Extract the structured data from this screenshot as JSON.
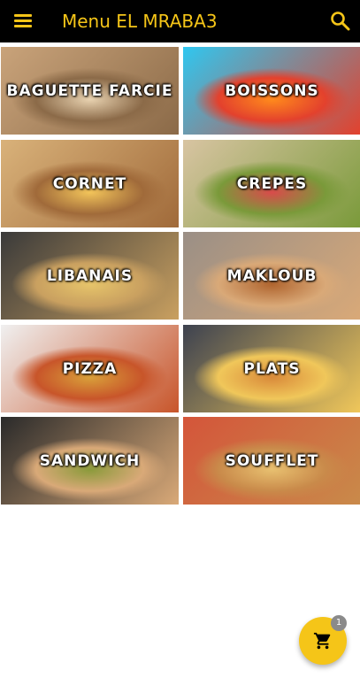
{
  "appbar": {
    "title": "Menu EL MRABA3",
    "menu_icon": "hamburger-menu-icon",
    "search_icon": "search-icon",
    "background": "#000000",
    "accent": "#F5C518"
  },
  "categories": [
    {
      "label": "BAGUETTE FARCIE",
      "colors": [
        "#c9a37a",
        "#8b6a48",
        "#e8d2b0"
      ]
    },
    {
      "label": "BOISSONS",
      "colors": [
        "#2fc7f0",
        "#e3412d",
        "#ff8a1c"
      ]
    },
    {
      "label": "CORNET",
      "colors": [
        "#d9b27a",
        "#a06a3a",
        "#f2c45a"
      ]
    },
    {
      "label": "CREPES",
      "colors": [
        "#d8c4a2",
        "#7a9a3a",
        "#d94b4b"
      ]
    },
    {
      "label": "LIBANAIS",
      "colors": [
        "#3a3a3a",
        "#c9a060",
        "#e6c46a"
      ]
    },
    {
      "label": "MAKLOUB",
      "colors": [
        "#9a8f86",
        "#d9a978",
        "#b0652f"
      ]
    },
    {
      "label": "PIZZA",
      "colors": [
        "#f0f0f0",
        "#c8552a",
        "#d9a03a"
      ]
    },
    {
      "label": "PLATS",
      "colors": [
        "#3d4250",
        "#f0c75a",
        "#d98a3a"
      ]
    },
    {
      "label": "SANDWICH",
      "colors": [
        "#2a2a2a",
        "#d9a978",
        "#8a9a3a"
      ]
    },
    {
      "label": "SOUFFLET",
      "colors": [
        "#d4553a",
        "#c98a4a",
        "#e8c070"
      ]
    }
  ],
  "cart": {
    "icon": "shopping-cart-icon",
    "count": "1",
    "fab_color": "#F5C518",
    "badge_color": "#8a8a8a"
  }
}
